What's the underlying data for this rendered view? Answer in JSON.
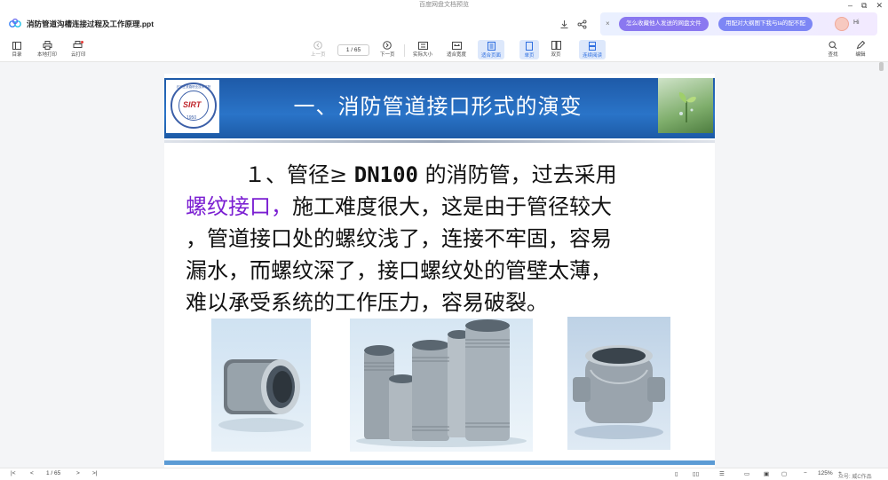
{
  "window": {
    "title": "百度网盘文档预览",
    "controls": [
      "–",
      "⧉",
      "✕"
    ]
  },
  "header": {
    "doc_title": "消防管道沟槽连接过程及工作原理.ppt",
    "promo_close": "×",
    "promo_pill_1": "怎么收藏他人发送的网盘文件",
    "promo_pill_2": "用配对大纲图下我与ta的配不配",
    "greeting": "Hi"
  },
  "toolbar": {
    "toc": "目录",
    "local_print": "本地打印",
    "cloud_print": "云打印",
    "prev": "上一页",
    "page_indicator": "1 / 65",
    "next": "下一页",
    "actual_size": "实际大小",
    "fit_width": "适合宽度",
    "fit_page": "适合页面",
    "single_page": "单页",
    "double_page": "双页",
    "continuous": "连续阅读",
    "find": "查找",
    "edit": "编辑"
  },
  "slide": {
    "title": "一、消防管道接口形式的演变",
    "badge_year": "1950",
    "badge_ring": "石家庄铁路职业技术学院",
    "badge_logo_text": "SIRT",
    "paragraph": {
      "l1_pre": "１、管径≥ ",
      "l1_mono": "DN100",
      "l1_post": " 的消防管，过去采用",
      "l2_hl": "螺纹接口，",
      "l2_post": "施工难度很大，这是由于管径较大",
      "l3": "，管道接口处的螺纹浅了，连接不牢固，容易",
      "l4": "漏水，而螺纹深了，接口螺纹处的管壁太薄，",
      "l5": "难以承受系统的工作压力，容易破裂。"
    }
  },
  "statusbar": {
    "first": "|<",
    "prev": "<",
    "page": "1 / 65",
    "next": ">",
    "last": ">|",
    "zoom": "125%",
    "zoom_minus": "−",
    "zoom_plus": "+",
    "footer_label": "众号: 威C作品"
  },
  "colors": {
    "accent": "#7b1fd2",
    "banner": "#2a74c8",
    "pill": "#8a78f0"
  }
}
